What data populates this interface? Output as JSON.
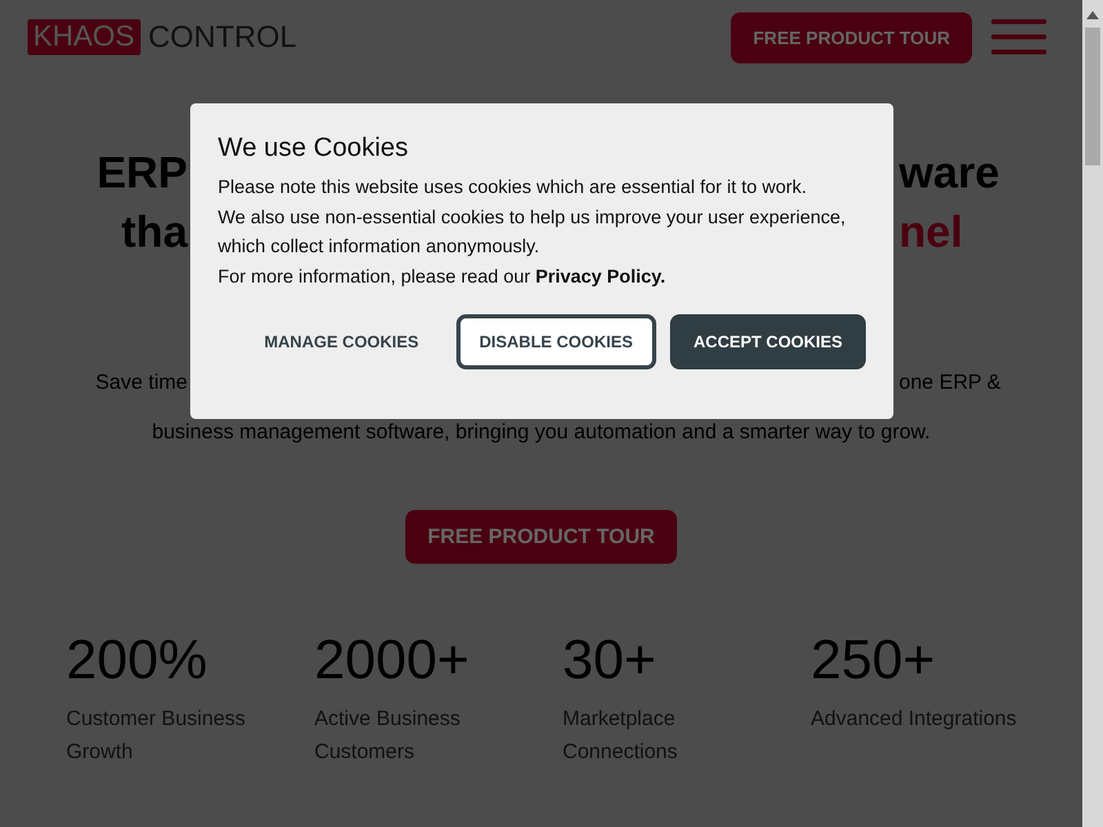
{
  "header": {
    "logo_mark": "KHAOS",
    "logo_text": "CONTROL",
    "tour_button": "FREE PRODUCT TOUR"
  },
  "hero": {
    "headline_lines": [
      {
        "left": "ERP",
        "right": "ware",
        "right_accent": false
      },
      {
        "left": "tha",
        "right": "nel",
        "right_accent": true
      }
    ],
    "intro_line": {
      "left": "Save time",
      "right": "one ERP &"
    },
    "intro_tail": "business management software, bringing you automation and a smarter way to grow.",
    "tour_button": "FREE PRODUCT TOUR"
  },
  "stats": [
    {
      "value": "200%",
      "label": "Customer Business Growth"
    },
    {
      "value": "2000+",
      "label": "Active Business Customers"
    },
    {
      "value": "30+",
      "label": "Marketplace Connections"
    },
    {
      "value": "250+",
      "label": "Advanced Integrations"
    }
  ],
  "cookie_dialog": {
    "title": "We use Cookies",
    "lines": [
      "Please note this website uses cookies which are essential for it to work.",
      "We also use non-essential cookies to help us improve your user experience, which collect information anonymously."
    ],
    "more_info": "For more information, please read our",
    "link": "Privacy Policy.",
    "buttons": [
      {
        "label": "MANAGE COOKIES",
        "kind": "text"
      },
      {
        "label": "DISABLE COOKIES",
        "kind": "outline"
      },
      {
        "label": "ACCEPT COOKIES",
        "kind": "filled"
      }
    ]
  }
}
